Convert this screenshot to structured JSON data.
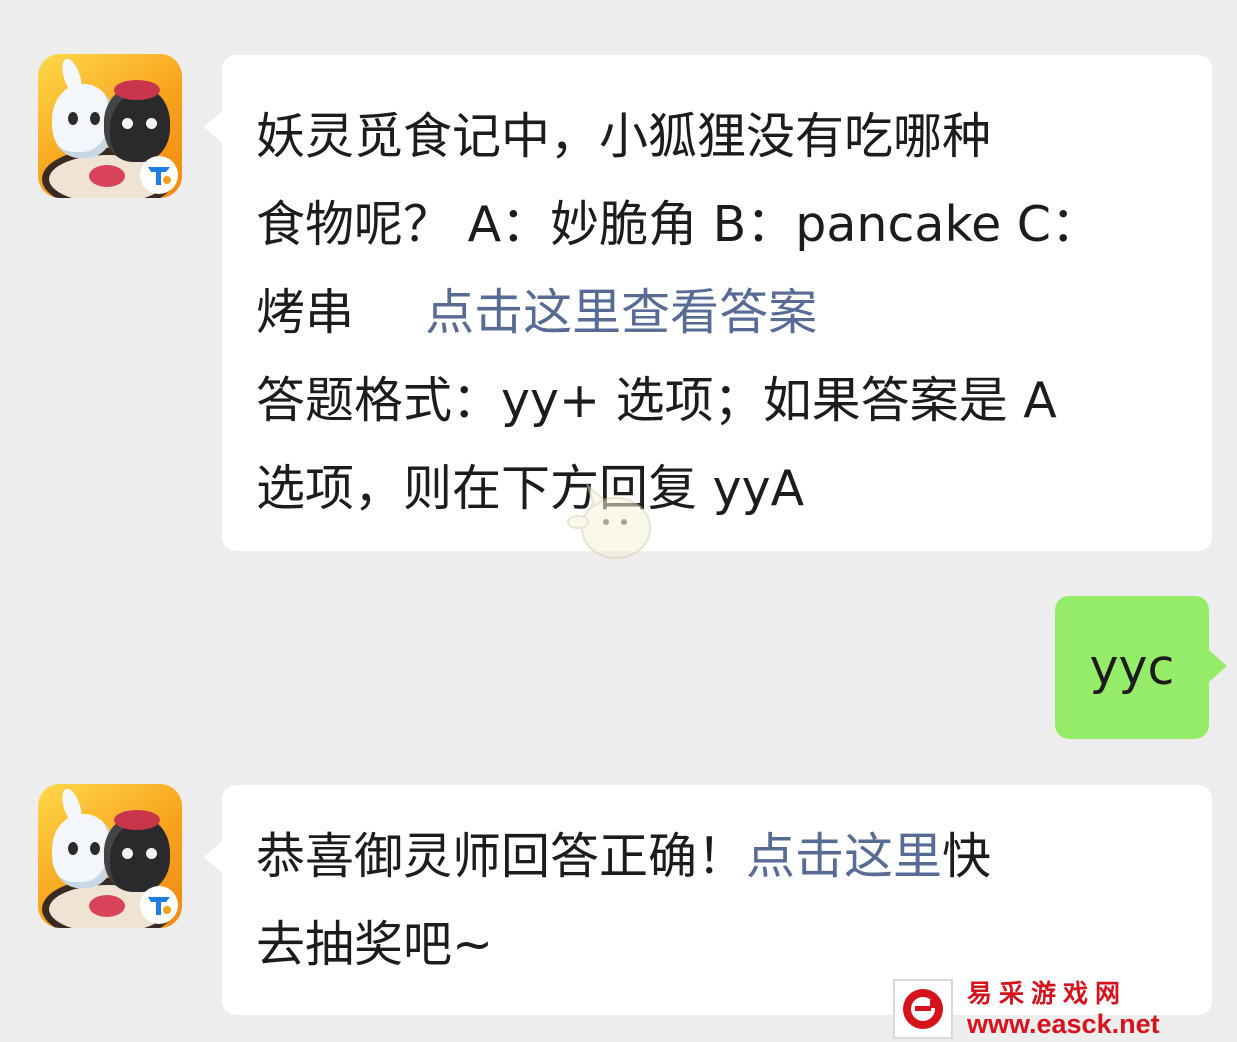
{
  "colors": {
    "background": "#ededed",
    "incoming_bubble": "#ffffff",
    "outgoing_bubble": "#95ec69",
    "link": "#576b95",
    "text": "#1c1c1c",
    "watermark_red": "#d6131d"
  },
  "chat": {
    "messages": [
      {
        "sender": "official-account",
        "avatar_icon": "game-avatar-icon",
        "lines": [
          {
            "text": "妖灵觅食记中，小狐狸没有吃哪种"
          },
          {
            "text": "食物呢？ A：妙脆角 B：pancake C："
          },
          {
            "text": "烤串",
            "link": "点击这里查看答案"
          },
          {
            "text": "答题格式：yy+ 选项；如果答案是 A"
          },
          {
            "text": "选项，则在下方回复 yyA"
          }
        ]
      },
      {
        "sender": "me",
        "text": "yyc"
      },
      {
        "sender": "official-account",
        "avatar_icon": "game-avatar-icon",
        "line1_before": "恭喜御灵师回答正确！",
        "line1_link": "点击这里",
        "line1_after": "快",
        "line2": "去抽奖吧~"
      }
    ]
  },
  "watermark": {
    "center_icon": "mascot-watermark-icon",
    "brand_icon": "easck-logo-icon",
    "brand_name": "易采游戏网",
    "brand_url": "www.easck.net"
  }
}
